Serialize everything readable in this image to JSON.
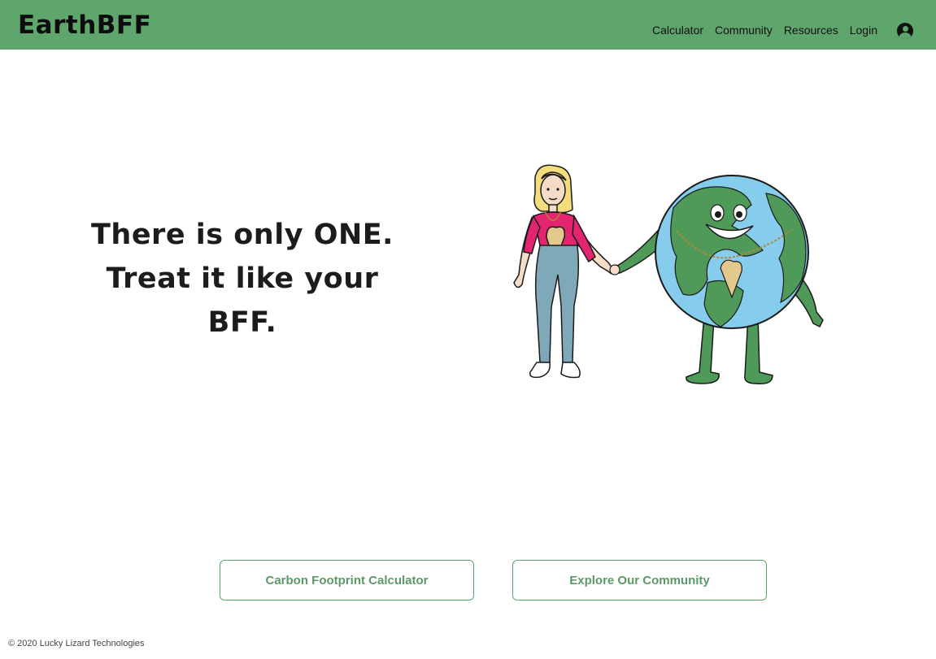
{
  "nav": {
    "brand": "EarthBFF",
    "links": [
      "Calculator",
      "Community",
      "Resources",
      "Login"
    ],
    "account_icon": "user-circle-icon"
  },
  "hero": {
    "tagline_lines": [
      "There is only ONE.",
      "Treat it like your",
      "BFF."
    ],
    "illustration": "woman-and-earth-holding-hands"
  },
  "actions": {
    "calculator_label": "Carbon Footprint Calculator",
    "community_label": "Explore Our Community"
  },
  "footer": {
    "copyright": "© 2020 Lucky Lizard Technologies"
  },
  "colors": {
    "brand_green": "#5fa66c",
    "button_text": "#5b9a68",
    "earth_ocean": "#86ccec",
    "earth_land": "#4f9a58",
    "shirt": "#e3246e",
    "jeans": "#7fa8b8",
    "hair": "#f3dc7c",
    "pendant": "#e2c88a"
  }
}
